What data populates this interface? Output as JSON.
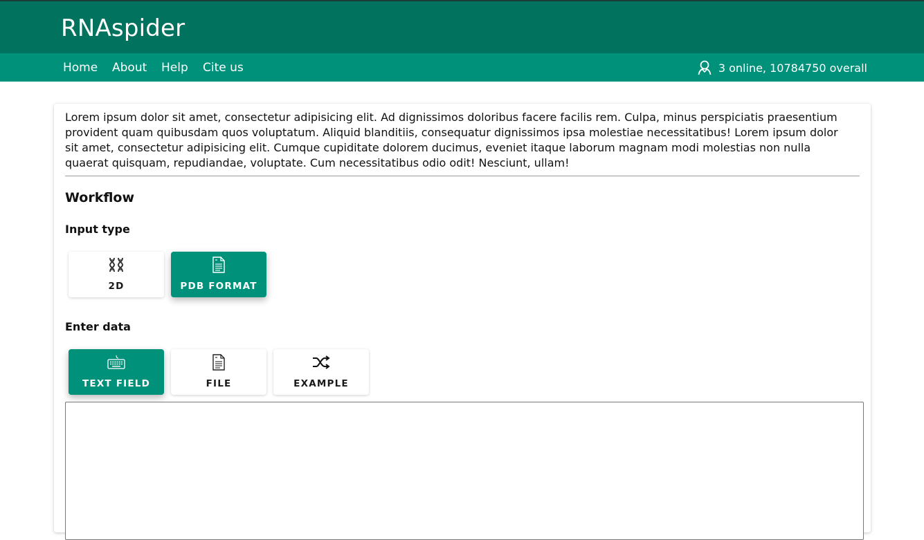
{
  "header": {
    "title": "RNAspider"
  },
  "nav": {
    "links": [
      "Home",
      "About",
      "Help",
      "Cite us"
    ],
    "online_text": "3 online, 10784750 overall"
  },
  "intro_text": "Lorem ipsum dolor sit amet, consectetur adipisicing elit. Ad dignissimos doloribus facere facilis rem. Culpa, minus perspiciatis praesentium provident quam quibusdam quos voluptatum. Aliquid blanditiis, consequatur dignissimos ipsa molestiae necessitatibus! Lorem ipsum dolor sit amet, consectetur adipisicing elit. Cumque cupiditate dolorem ducimus, eveniet itaque laborum magnam modi molestias non nulla quaerat quisquam, repudiandae, voluptate. Cum necessitatibus odio odit! Nesciunt, ullam!",
  "workflow": {
    "heading": "Workflow",
    "input_type": {
      "heading": "Input type",
      "options": [
        {
          "label": "2D",
          "icon": "dna-icon",
          "selected": false
        },
        {
          "label": "PDB FORMAT",
          "icon": "document-icon",
          "selected": true
        }
      ]
    },
    "enter_data": {
      "heading": "Enter data",
      "options": [
        {
          "label": "TEXT FIELD",
          "icon": "keyboard-icon",
          "selected": true
        },
        {
          "label": "FILE",
          "icon": "document-icon",
          "selected": false
        },
        {
          "label": "EXAMPLE",
          "icon": "shuffle-icon",
          "selected": false
        }
      ]
    },
    "textarea_value": ""
  },
  "colors": {
    "header_bg": "#00725e",
    "nav_bg": "#00917a",
    "accent": "#00917a"
  }
}
